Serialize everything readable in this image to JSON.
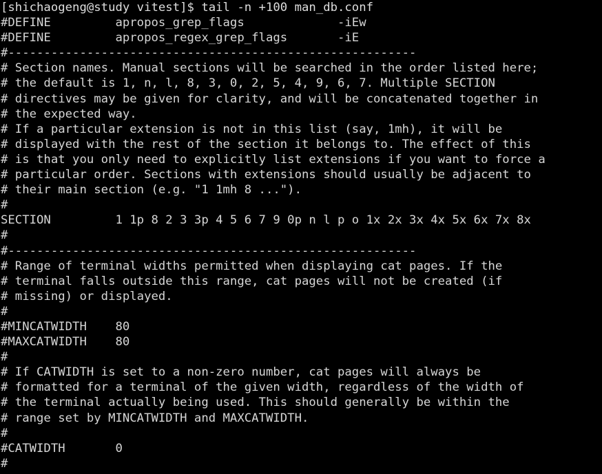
{
  "terminal": {
    "prompt_user": "shichaogeng",
    "prompt_host": "study",
    "prompt_dir": "vitest",
    "command": "tail -n +100 man_db.conf",
    "foreground_color": "#d6d6d6",
    "background_color": "#000000",
    "columns": 77,
    "rows": 31,
    "lines": [
      "[shichaogeng@study vitest]$ tail -n +100 man_db.conf",
      "#DEFINE         apropos_grep_flags             -iEw",
      "#DEFINE         apropos_regex_grep_flags       -iE",
      "#---------------------------------------------------------",
      "# Section names. Manual sections will be searched in the order listed here;",
      "# the default is 1, n, l, 8, 3, 0, 2, 5, 4, 9, 6, 7. Multiple SECTION",
      "# directives may be given for clarity, and will be concatenated together in",
      "# the expected way.",
      "# If a particular extension is not in this list (say, 1mh), it will be",
      "# displayed with the rest of the section it belongs to. The effect of this",
      "# is that you only need to explicitly list extensions if you want to force a",
      "# particular order. Sections with extensions should usually be adjacent to",
      "# their main section (e.g. \"1 1mh 8 ...\").",
      "#",
      "SECTION         1 1p 8 2 3 3p 4 5 6 7 9 0p n l p o 1x 2x 3x 4x 5x 6x 7x 8x",
      "#",
      "#---------------------------------------------------------",
      "# Range of terminal widths permitted when displaying cat pages. If the",
      "# terminal falls outside this range, cat pages will not be created (if",
      "# missing) or displayed.",
      "#",
      "#MINCATWIDTH    80",
      "#MAXCATWIDTH    80",
      "#",
      "# If CATWIDTH is set to a non-zero number, cat pages will always be",
      "# formatted for a terminal of the given width, regardless of the width of",
      "# the terminal actually being used. This should generally be within the",
      "# range set by MINCATWIDTH and MAXCATWIDTH.",
      "#",
      "#CATWIDTH       0",
      "#"
    ]
  }
}
